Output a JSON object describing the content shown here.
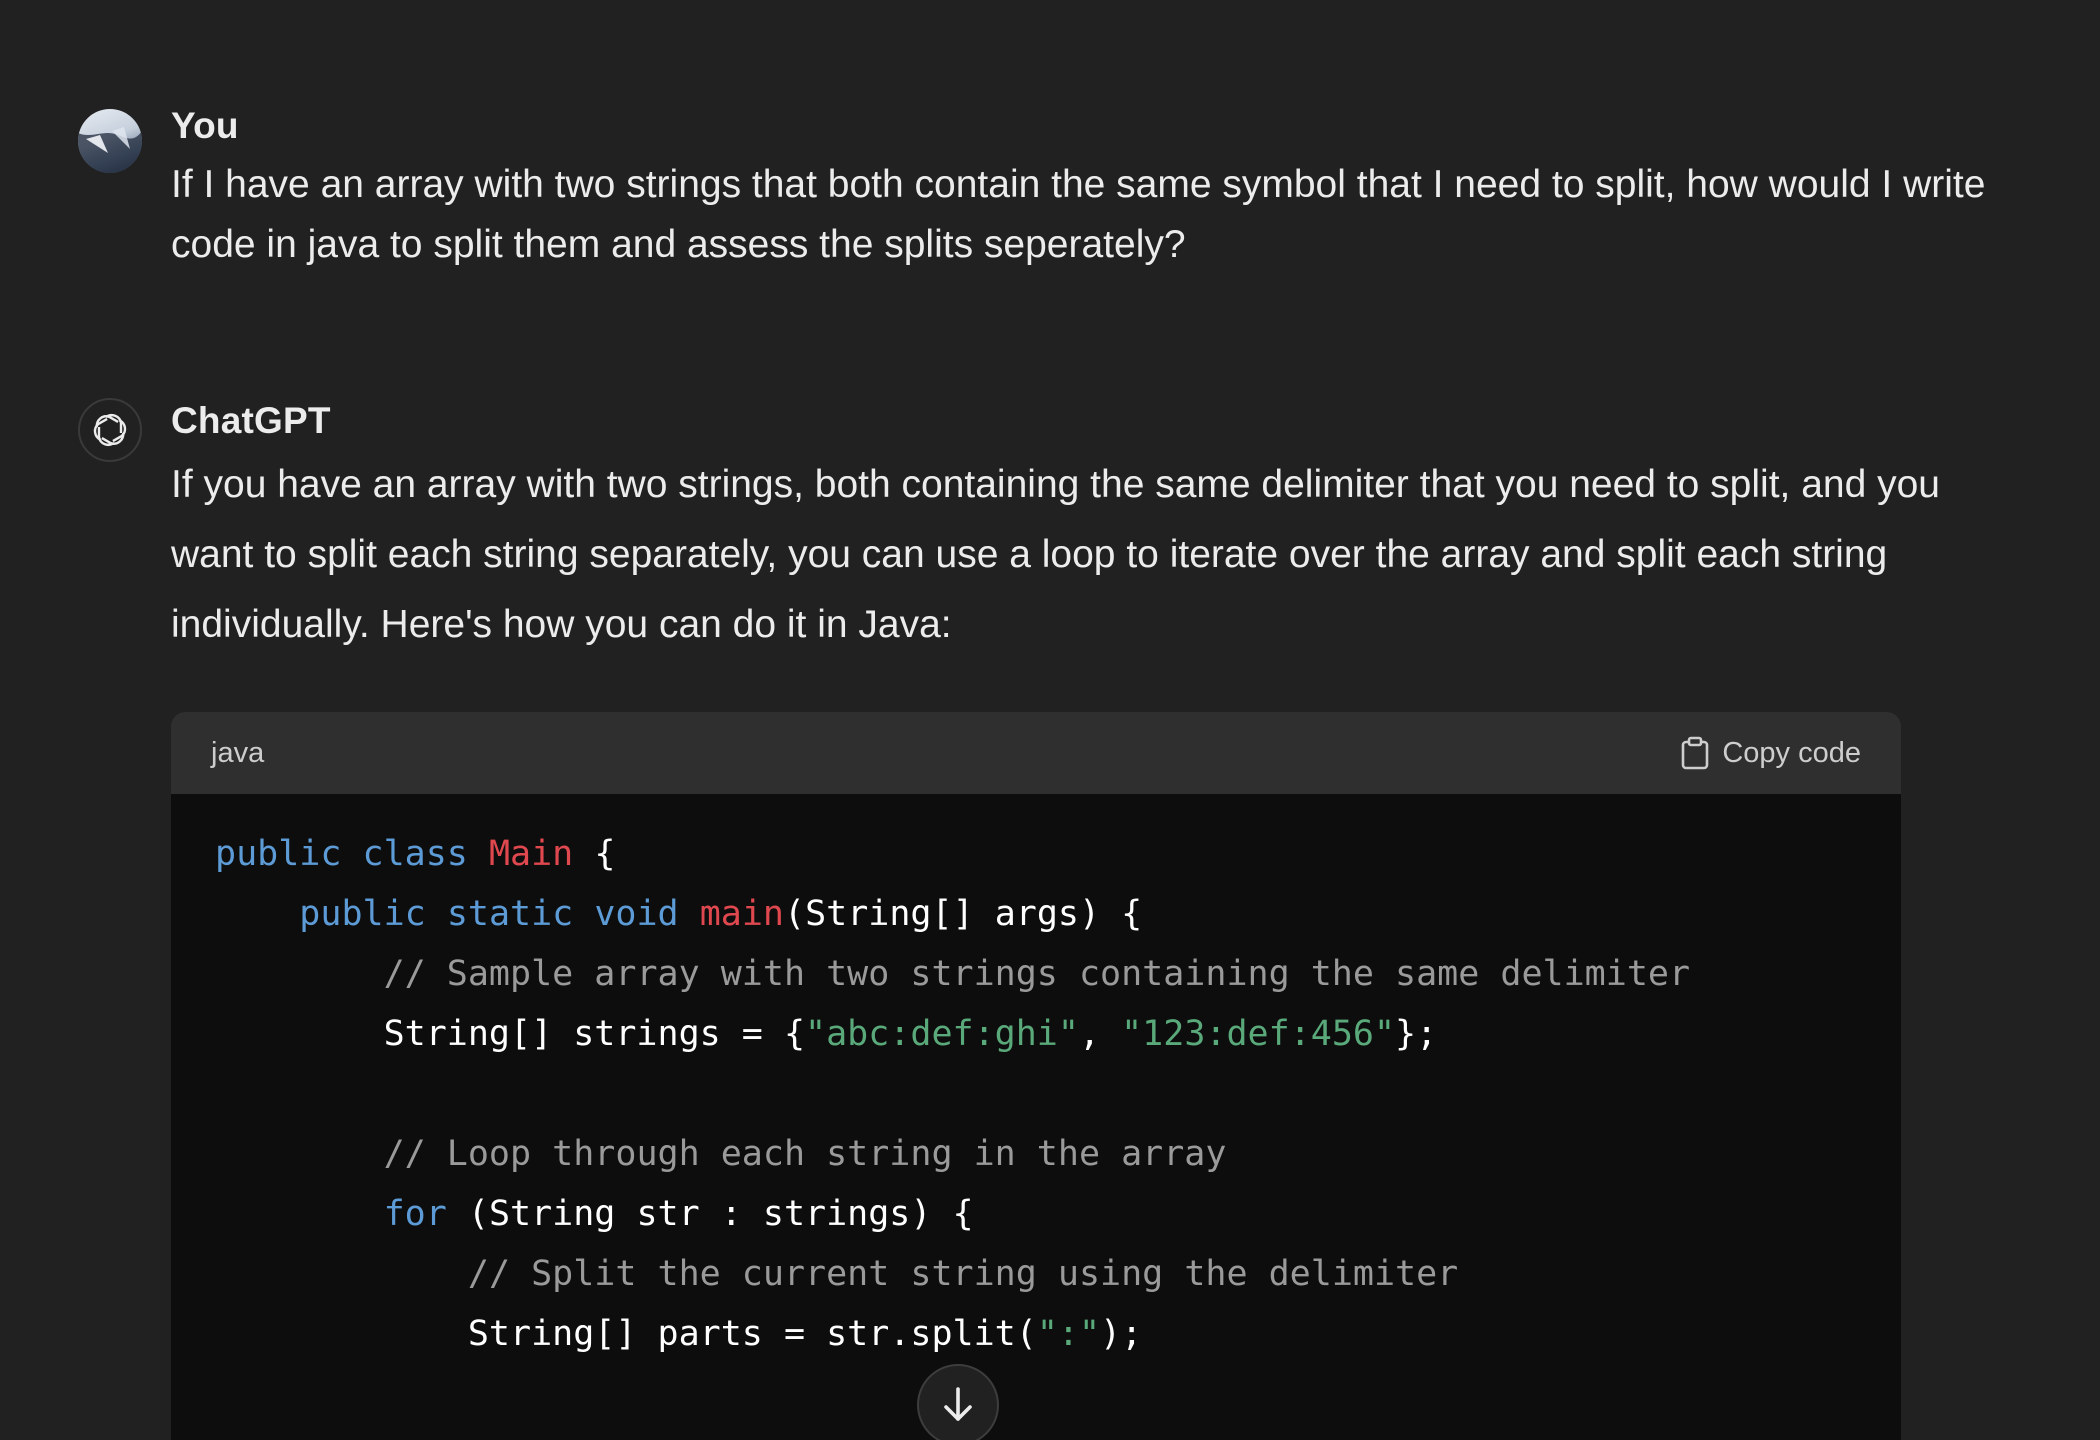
{
  "user_message": {
    "author": "You",
    "text": "If I have an array with two strings that both contain the same symbol that I need to split, how would I write code in java to split them and assess the splits seperately?"
  },
  "assistant_message": {
    "author": "ChatGPT",
    "text": "If you have an array with two strings, both containing the same delimiter that you need to split, and you want to split each string separately, you can use a loop to iterate over the array and split each string individually. Here's how you can do it in Java:",
    "code_block": {
      "language": "java",
      "copy_label": "Copy code",
      "lines": [
        [
          {
            "t": "kw",
            "v": "public"
          },
          {
            "t": "p",
            "v": " "
          },
          {
            "t": "kw",
            "v": "class"
          },
          {
            "t": "p",
            "v": " "
          },
          {
            "t": "cls",
            "v": "Main"
          },
          {
            "t": "p",
            "v": " {"
          }
        ],
        [
          {
            "t": "p",
            "v": "    "
          },
          {
            "t": "kw",
            "v": "public"
          },
          {
            "t": "p",
            "v": " "
          },
          {
            "t": "kw",
            "v": "static"
          },
          {
            "t": "p",
            "v": " "
          },
          {
            "t": "kw",
            "v": "void"
          },
          {
            "t": "p",
            "v": " "
          },
          {
            "t": "cls",
            "v": "main"
          },
          {
            "t": "p",
            "v": "(String[] args) {"
          }
        ],
        [
          {
            "t": "p",
            "v": "        "
          },
          {
            "t": "cm",
            "v": "// Sample array with two strings containing the same delimiter"
          }
        ],
        [
          {
            "t": "p",
            "v": "        String[] strings = {"
          },
          {
            "t": "str",
            "v": "\"abc:def:ghi\""
          },
          {
            "t": "p",
            "v": ", "
          },
          {
            "t": "str",
            "v": "\"123:def:456\""
          },
          {
            "t": "p",
            "v": "};"
          }
        ],
        [
          {
            "t": "p",
            "v": ""
          }
        ],
        [
          {
            "t": "p",
            "v": "        "
          },
          {
            "t": "cm",
            "v": "// Loop through each string in the array"
          }
        ],
        [
          {
            "t": "p",
            "v": "        "
          },
          {
            "t": "kw",
            "v": "for"
          },
          {
            "t": "p",
            "v": " (String str : strings) {"
          }
        ],
        [
          {
            "t": "p",
            "v": "            "
          },
          {
            "t": "cm",
            "v": "// Split the current string using the delimiter"
          }
        ],
        [
          {
            "t": "p",
            "v": "            String[] parts = str.split("
          },
          {
            "t": "str",
            "v": "\":\""
          },
          {
            "t": "p",
            "v": ");"
          }
        ]
      ]
    }
  },
  "icons": {
    "user_avatar": "user-avatar",
    "assistant_avatar": "openai-logo-icon",
    "copy": "clipboard-icon",
    "scroll_down": "arrow-down-icon"
  },
  "colors": {
    "background": "#212121",
    "code_background": "#0d0d0d",
    "code_header": "#2f2f2f",
    "keyword": "#5d9bd6",
    "identifier": "#e0484f",
    "comment": "#9a9a9a",
    "string": "#5aa97a"
  }
}
